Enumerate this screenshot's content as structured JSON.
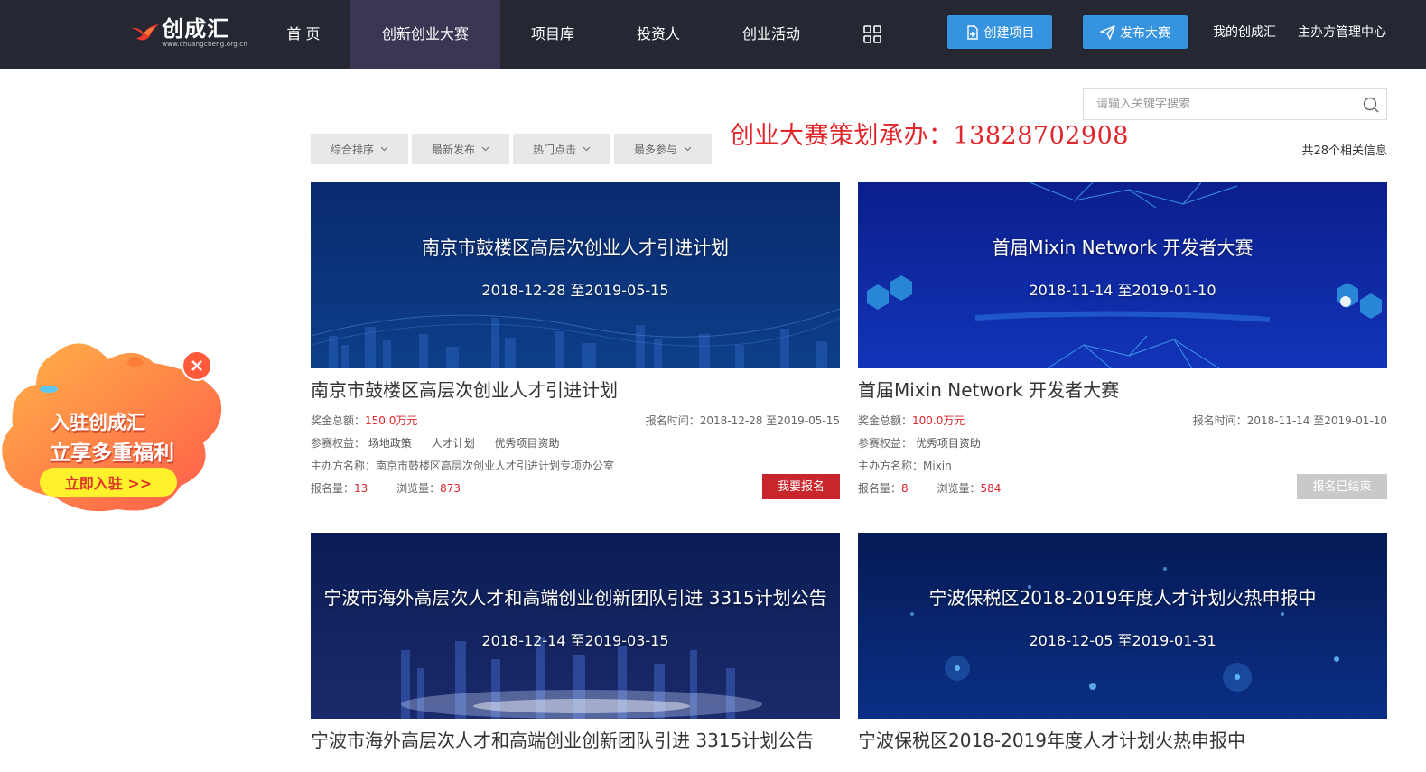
{
  "header": {
    "logo_name": "创成汇",
    "logo_url": "www.chuangcheng.org.cn",
    "nav": [
      {
        "label": "首 页"
      },
      {
        "label": "创新创业大赛"
      },
      {
        "label": "项目库"
      },
      {
        "label": "投资人"
      },
      {
        "label": "创业活动"
      }
    ],
    "create_project": "创建项目",
    "publish_contest": "发布大赛",
    "my_link": "我的创成汇",
    "host_center": "主办方管理中心"
  },
  "search": {
    "placeholder": "请输入关键字搜索"
  },
  "sort_tabs": [
    {
      "label": "综合排序"
    },
    {
      "label": "最新发布"
    },
    {
      "label": "热门点击"
    },
    {
      "label": "最多参与"
    }
  ],
  "watermark": "创业大赛策划承办：13828702908",
  "result_count": "共28个相关信息",
  "labels": {
    "prize_total": "奖金总额：",
    "benefits": "参赛权益：",
    "host": "主办方名称：",
    "signup_time": "报名时间：",
    "signups": "报名量：",
    "views": "浏览量："
  },
  "contests": [
    {
      "banner_title": "南京市鼓楼区高层次创业人才引进计划",
      "banner_dates": "2018-12-28 至2019-05-15",
      "title": "南京市鼓楼区高层次创业人才引进计划",
      "prize": "150.0万元",
      "signup_time": "2018-12-28 至2019-05-15",
      "benefits": [
        "场地政策",
        "人才计划",
        "优秀项目资助"
      ],
      "host": "南京市鼓楼区高层次创业人才引进计划专项办公室",
      "signups": "13",
      "views": "873",
      "action": "我要报名",
      "colors": {
        "top": "#0a2a6e",
        "bottom": "#0d3f8a"
      }
    },
    {
      "banner_title": "首届Mixin Network 开发者大赛",
      "banner_dates": "2018-11-14 至2019-01-10",
      "title": "首届Mixin Network 开发者大赛",
      "prize": "100.0万元",
      "signup_time": "2018-11-14 至2019-01-10",
      "benefits": [
        "优秀项目资助"
      ],
      "host": "Mixin",
      "signups": "8",
      "views": "584",
      "action": "报名已结束",
      "colors": {
        "top": "#0b1f8c",
        "bottom": "#1234b8"
      }
    },
    {
      "banner_title": "宁波市海外高层次人才和高端创业创新团队引进 3315计划公告",
      "banner_dates": "2018-12-14 至2019-03-15",
      "title": "宁波市海外高层次人才和高端创业创新团队引进 3315计划公告",
      "colors": {
        "top": "#0a1d55",
        "bottom": "#1b2a6a"
      }
    },
    {
      "banner_title": "宁波保税区2018-2019年度人才计划火热申报中",
      "banner_dates": "2018-12-05 至2019-01-31",
      "title": "宁波保税区2018-2019年度人才计划火热申报中",
      "colors": {
        "top": "#061a55",
        "bottom": "#0a2f86"
      }
    }
  ],
  "promo": {
    "line1": "入驻创成汇",
    "line2": "立享多重福利",
    "button": "立即入驻 >>"
  }
}
